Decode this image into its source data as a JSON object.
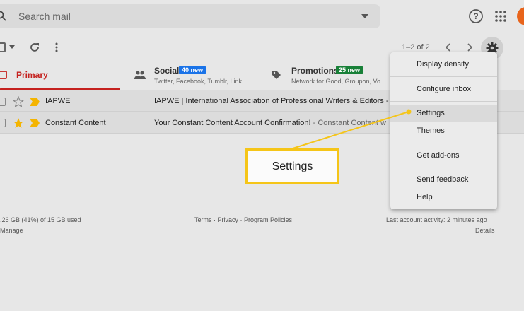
{
  "search": {
    "placeholder": "Search mail"
  },
  "toolbar": {
    "pagination": "1–2 of 2"
  },
  "tabs": [
    {
      "label": "Primary"
    },
    {
      "label": "Social",
      "badge": "40 new",
      "sub": "Twitter, Facebook, Tumblr, Link..."
    },
    {
      "label": "Promotions",
      "badge": "25 new",
      "sub": "Network for Good, Groupon, Vo..."
    }
  ],
  "emails": [
    {
      "sender": "IAPWE",
      "subject": "IAPWE | International Association of Professional Writers & Editors -",
      "starred": false
    },
    {
      "sender": "Constant Content",
      "subject": "Your Constant Content Account Confirmation!",
      "snippet": " - Constant Content w",
      "starred": true
    }
  ],
  "footer": {
    "storage": ".26 GB (41%) of 15 GB used",
    "manage": "Manage",
    "links": "Terms · Privacy · Program Policies",
    "activity": "Last account activity: 2 minutes ago",
    "details": "Details"
  },
  "menu": {
    "items": [
      "Display density",
      "Configure inbox",
      "Settings",
      "Themes",
      "Get add-ons",
      "Send feedback",
      "Help"
    ]
  },
  "callout": {
    "label": "Settings"
  },
  "colors": {
    "primary_red": "#c5221f",
    "social_badge": "#1a73e8",
    "promo_badge": "#188038",
    "callout_border": "#f5c518",
    "star": "#f4b400",
    "avatar": "#e8641b"
  }
}
